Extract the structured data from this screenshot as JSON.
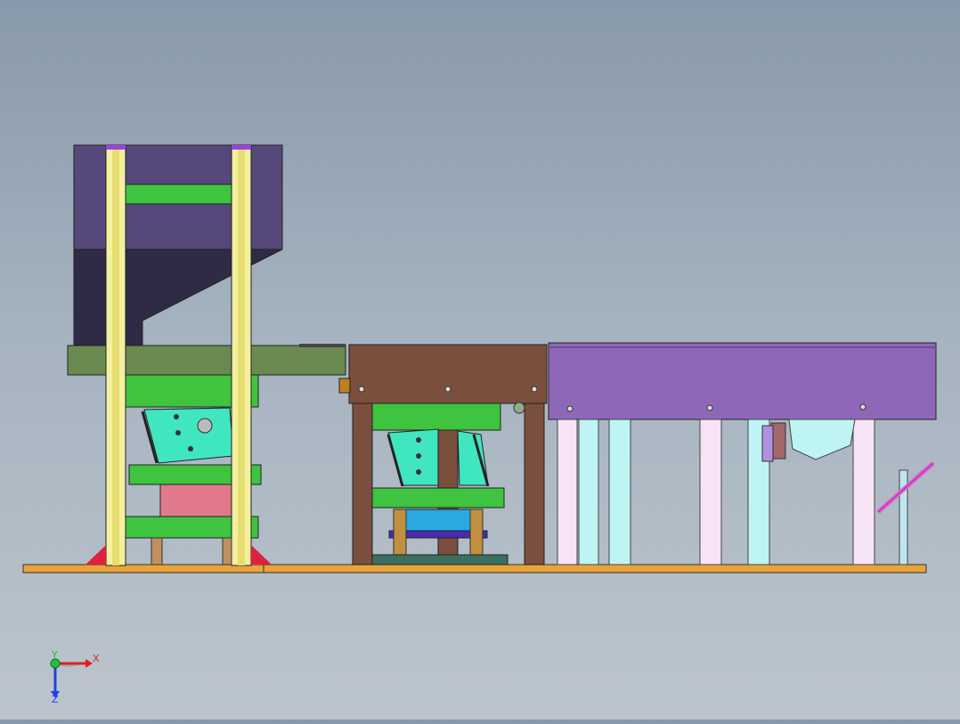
{
  "view": {
    "background_top": "#8899ab",
    "background_bottom": "#bcc5cd"
  },
  "triad": {
    "x_label": "X",
    "y_label": "Y",
    "z_label": "Z",
    "x_color": "#e02020",
    "y_color": "#20c040",
    "z_color": "#2040e0"
  },
  "parts": {
    "base_plate": "#e8a33a",
    "press_frame": "#56487a",
    "columns": "#f3f0a0",
    "green_plates": "#3ec43e",
    "olive_plate": "#6b8a52",
    "brown_table": "#7a4f3e",
    "purple_conveyor": "#8f67b8",
    "cyan_blocks": "#40e6c0",
    "pink_legs": "#f6e4f6",
    "aqua_legs": "#bff4f4"
  }
}
